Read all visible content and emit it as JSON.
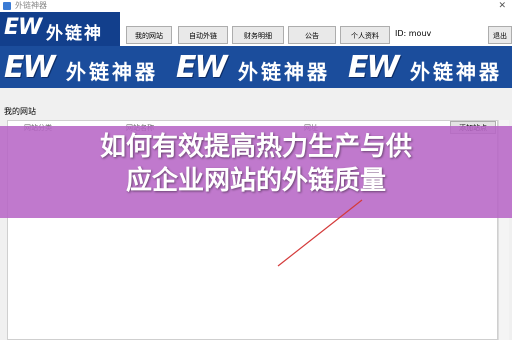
{
  "window": {
    "title": "外链神器"
  },
  "header": {
    "logo_ew": "EW",
    "logo_text": "外链神器",
    "tabs": [
      "我的网站",
      "自动外链",
      "财务明细",
      "公告",
      "个人资料"
    ],
    "user_id": "ID: mouv",
    "logout": "退出"
  },
  "banner": {
    "segments": [
      {
        "ew": "EW",
        "text": "外链神器"
      },
      {
        "ew": "EW",
        "text": "外链神器"
      },
      {
        "ew": "EW",
        "text": "外链神器"
      }
    ]
  },
  "section": {
    "label": "我的网站"
  },
  "table": {
    "columns": [
      "网站分类",
      "网站名称",
      "网址"
    ],
    "add_button": "添加站点"
  },
  "overlay": {
    "line1": "如何有效提高热力生产与供",
    "line2": "应企业网站的外链质量",
    "color": "#b766c6"
  }
}
